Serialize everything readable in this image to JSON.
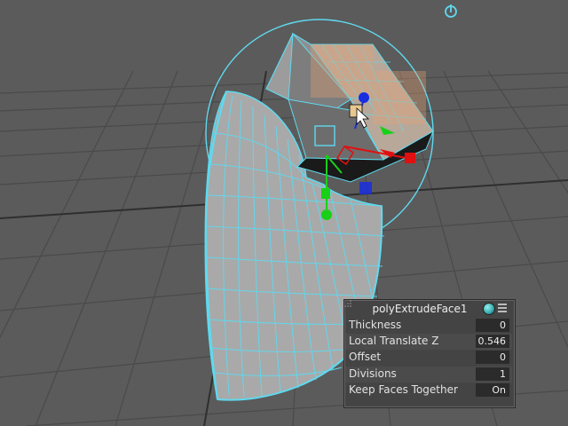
{
  "viewport": {
    "name": "perspective-viewport"
  },
  "hud": {
    "title": "polyExtrudeFace1",
    "rows": [
      {
        "label": "Thickness",
        "value": "0"
      },
      {
        "label": "Local Translate Z",
        "value": "0.546"
      },
      {
        "label": "Offset",
        "value": "0"
      },
      {
        "label": "Divisions",
        "value": "1"
      },
      {
        "label": "Keep Faces Together",
        "value": "On"
      }
    ]
  },
  "colors": {
    "background": "#5b5b5b",
    "grid": "#4a4a4a",
    "wireframe": "#5fd9ef",
    "mesh": "#a8a8a8",
    "axis_x": "#e01010",
    "axis_y": "#18d018",
    "axis_z": "#1a2ee0"
  },
  "icons": {
    "top_right": "manipulator-toggle-icon",
    "hud_circle": "node-editor-icon",
    "hud_menu": "hamburger-menu-icon"
  }
}
